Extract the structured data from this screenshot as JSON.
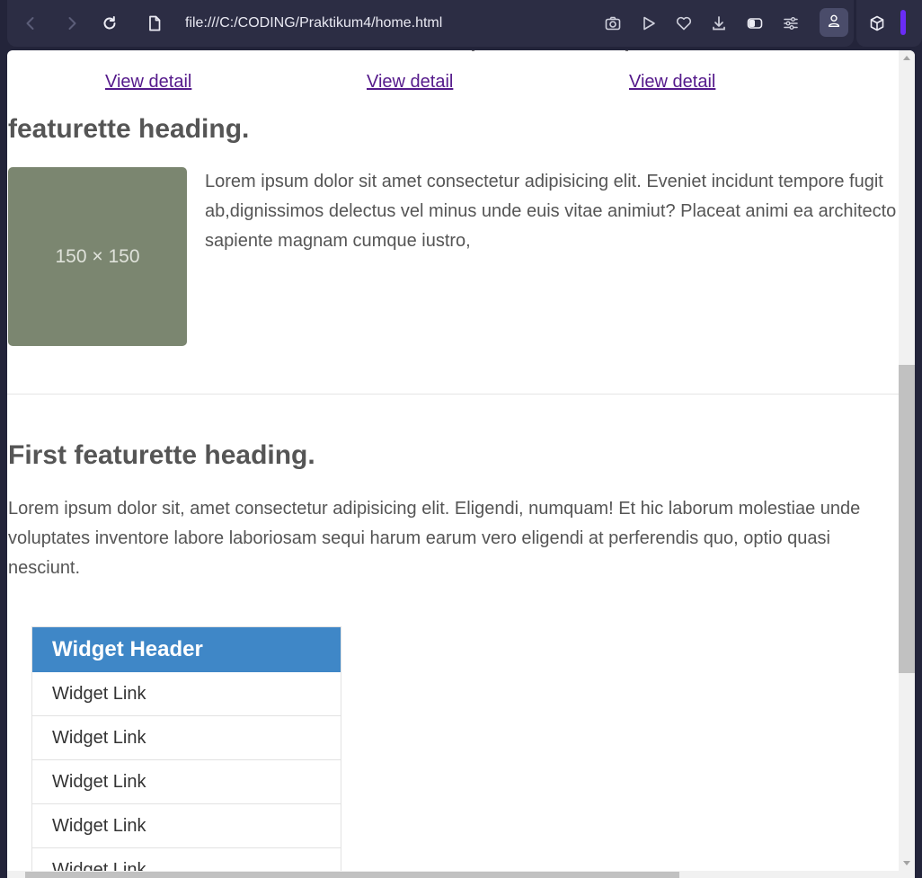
{
  "browser": {
    "url": "file:///C:/CODING/Praktikum4/home.html",
    "icons": [
      "back-icon",
      "forward-icon",
      "reload-icon",
      "page-icon",
      "camera-icon",
      "play-icon",
      "heart-icon",
      "download-icon",
      "sidebar-icon",
      "settings-icon",
      "profile-icon",
      "extensions-icon"
    ],
    "accent": "#6a2cf5"
  },
  "page": {
    "view_links": [
      "View detail",
      "View detail",
      "View detail"
    ],
    "featurette_heading": "featurette heading.",
    "placeholder_label": "150 × 150",
    "media_text": "Lorem ipsum dolor sit amet consectetur adipisicing elit. Eveniet incidunt tempore fugit ab,dignissimos delectus vel minus unde euis vitae animiut? Placeat animi ea architecto sapiente magnam cumque iustro,",
    "first_heading": "First featurette heading.",
    "lead_text": "Lorem ipsum dolor sit, amet consectetur adipisicing elit. Eligendi, numquam! Et hic laborum molestiae unde voluptates inventore labore laboriosam sequi harum earum vero eligendi at perferendis quo, optio quasi nesciunt.",
    "widget": {
      "header": "Widget Header",
      "links": [
        "Widget Link",
        "Widget Link",
        "Widget Link",
        "Widget Link",
        "Widget Link"
      ]
    },
    "colors": {
      "widget_header": "#3f87c7",
      "placeholder": "#7b8670",
      "link_visited": "#551a8b"
    }
  }
}
